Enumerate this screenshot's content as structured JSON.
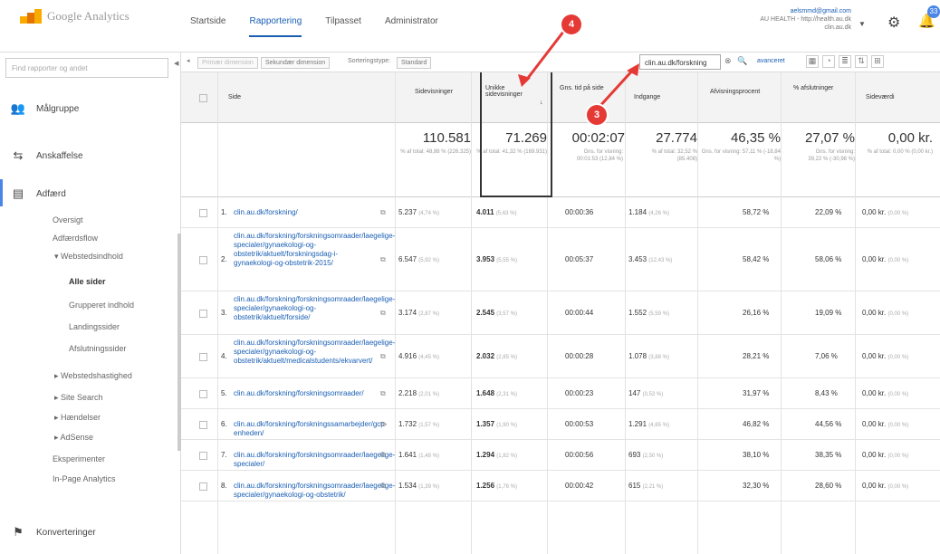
{
  "header": {
    "logo_text": "Google Analytics",
    "tabs": [
      "Startside",
      "Rapportering",
      "Tilpasset",
      "Administrator"
    ],
    "account_email": "aelsmmd@gmail.com",
    "account_line2": "AU HEALTH - http://health.au.dk",
    "account_line3": "clin.au.dk",
    "badge": "33"
  },
  "sidebar": {
    "search_placeholder": "Find rapporter og andet",
    "items": [
      "Målgruppe",
      "Anskaffelse",
      "Adfærd"
    ],
    "sub_items": [
      "Oversigt",
      "Adfærdsflow",
      "▾ Webstedsindhold",
      "Alle sider",
      "Grupperet indhold",
      "Landingssider",
      "Afslutningssider",
      "▸ Webstedshastighed",
      "▸ Site Search",
      "▸ Hændelser",
      "▸ AdSense",
      "Eksperimenter",
      "In-Page Analytics"
    ],
    "bottom": "Konverteringer"
  },
  "toolbar": {
    "primary": "Primær dimension",
    "secondary": "Sekundær dimension",
    "sort_type": "Sorteringstype:",
    "standard": "Standard",
    "filter_value": "clin.au.dk/forskning",
    "advanced": "avanceret"
  },
  "table": {
    "columns": [
      "Side",
      "Sidevisninger",
      "Unikke sidevisninger",
      "Gns. tid på side",
      "Indgange",
      "Afvisningsprocent",
      "% afslutninger",
      "Sideværdi"
    ],
    "totals": {
      "sidevisninger": "110.581",
      "unikke": "71.269",
      "tid": "00:02:07",
      "indgange": "27.774",
      "afvisning": "46,35 %",
      "afslutninger": "27,07 %",
      "sidevaerdi": "0,00 kr.",
      "sub_sidevisninger": "% af total: 48,86 % (226.325)",
      "sub_unikke": "% af total: 41,32 % (169.931)",
      "sub_tid": "Gns. for visning: 00:01:53 (12,84 %)",
      "sub_indgange": "% af total: 32,52 % (85.408)",
      "sub_afvisning": "Gns. for visning: 57,11 % (-18,84 %)",
      "sub_afslutninger": "Gns. for visning: 39,22 % (-30,98 %)",
      "sub_sidevaerdi": "% af total: 0,00 % (0,00 kr.)"
    },
    "rows": [
      {
        "n": "1.",
        "page": "clin.au.dk/forskning/",
        "sv": "5.237",
        "svp": "(4,74 %)",
        "u": "4.011",
        "up": "(5,63 %)",
        "t": "00:00:36",
        "i": "1.184",
        "ip": "(4,26 %)",
        "a": "58,72 %",
        "s": "22,09 %",
        "v": "0,00 kr.",
        "vp": "(0,00 %)"
      },
      {
        "n": "2.",
        "page": "clin.au.dk/forskning/forskningsomraader/laegelige-specialer/gynaekologi-og-obstetrik/aktuelt/forskningsdag-i-gynaekologi-og-obstetrik-2015/",
        "sv": "6.547",
        "svp": "(5,92 %)",
        "u": "3.953",
        "up": "(5,55 %)",
        "t": "00:05:37",
        "i": "3.453",
        "ip": "(12,43 %)",
        "a": "58,42 %",
        "s": "58,06 %",
        "v": "0,00 kr.",
        "vp": "(0,00 %)"
      },
      {
        "n": "3.",
        "page": "clin.au.dk/forskning/forskningsomraader/laegelige-specialer/gynaekologi-og-obstetrik/aktuelt/forside/",
        "sv": "3.174",
        "svp": "(2,87 %)",
        "u": "2.545",
        "up": "(3,57 %)",
        "t": "00:00:44",
        "i": "1.552",
        "ip": "(5,59 %)",
        "a": "26,16 %",
        "s": "19,09 %",
        "v": "0,00 kr.",
        "vp": "(0,00 %)"
      },
      {
        "n": "4.",
        "page": "clin.au.dk/forskning/forskningsomraader/laegelige-specialer/gynaekologi-og-obstetrik/aktuelt/medicalstudents/ekvarvert/",
        "sv": "4.916",
        "svp": "(4,45 %)",
        "u": "2.032",
        "up": "(2,85 %)",
        "t": "00:00:28",
        "i": "1.078",
        "ip": "(3,88 %)",
        "a": "28,21 %",
        "s": "7,06 %",
        "v": "0,00 kr.",
        "vp": "(0,00 %)"
      },
      {
        "n": "5.",
        "page": "clin.au.dk/forskning/forskningsomraader/",
        "sv": "2.218",
        "svp": "(2,01 %)",
        "u": "1.648",
        "up": "(2,31 %)",
        "t": "00:00:23",
        "i": "147",
        "ip": "(0,53 %)",
        "a": "31,97 %",
        "s": "8,43 %",
        "v": "0,00 kr.",
        "vp": "(0,00 %)"
      },
      {
        "n": "6.",
        "page": "clin.au.dk/forskning/forskningssamarbejder/gcp-enheden/",
        "sv": "1.732",
        "svp": "(1,57 %)",
        "u": "1.357",
        "up": "(1,90 %)",
        "t": "00:00:53",
        "i": "1.291",
        "ip": "(4,65 %)",
        "a": "46,82 %",
        "s": "44,56 %",
        "v": "0,00 kr.",
        "vp": "(0,00 %)"
      },
      {
        "n": "7.",
        "page": "clin.au.dk/forskning/forskningsomraader/laegelige-specialer/",
        "sv": "1.641",
        "svp": "(1,48 %)",
        "u": "1.294",
        "up": "(1,82 %)",
        "t": "00:00:56",
        "i": "693",
        "ip": "(2,50 %)",
        "a": "38,10 %",
        "s": "38,35 %",
        "v": "0,00 kr.",
        "vp": "(0,00 %)"
      },
      {
        "n": "8.",
        "page": "clin.au.dk/forskning/forskningsomraader/laegelige-specialer/gynaekologi-og-obstetrik/",
        "sv": "1.534",
        "svp": "(1,39 %)",
        "u": "1.256",
        "up": "(1,76 %)",
        "t": "00:00:42",
        "i": "615",
        "ip": "(2,21 %)",
        "a": "32,30 %",
        "s": "28,60 %",
        "v": "0,00 kr.",
        "vp": "(0,00 %)"
      }
    ]
  },
  "annotations": {
    "a3": "3",
    "a4": "4"
  },
  "colors": {
    "accent": "#1a5fb4",
    "annotation": "#e53935"
  }
}
